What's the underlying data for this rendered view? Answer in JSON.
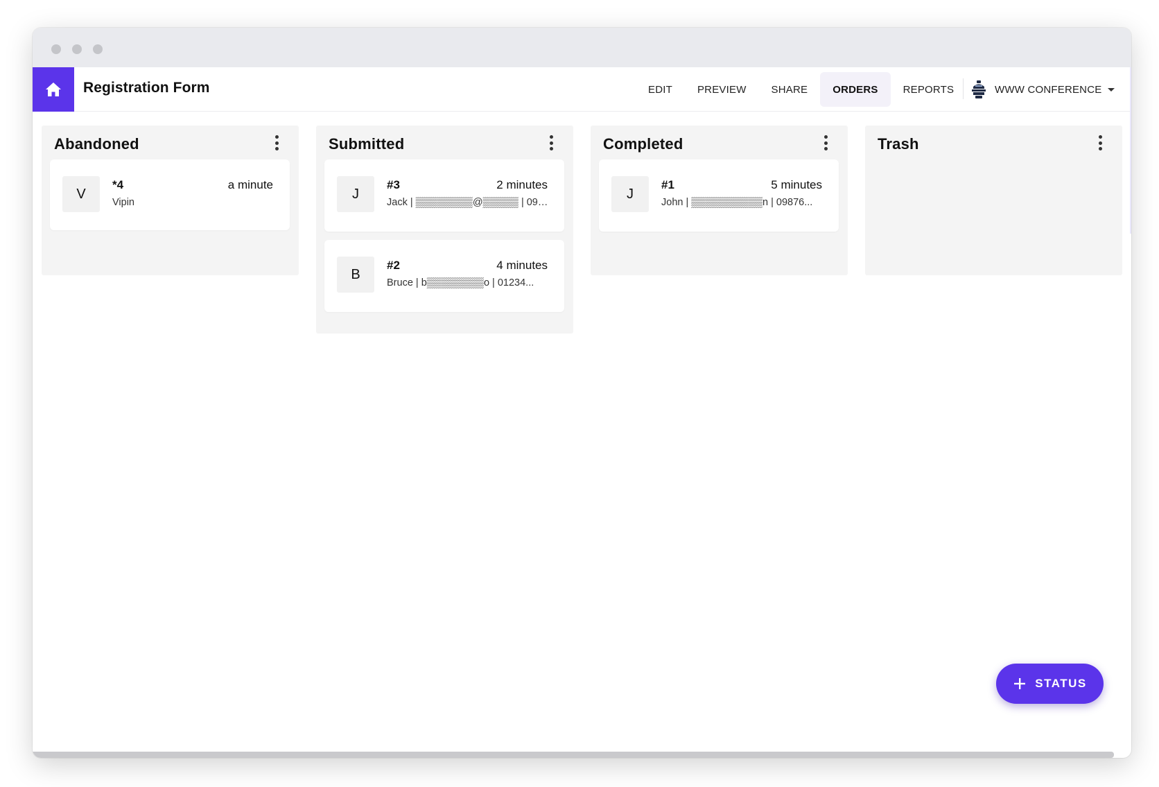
{
  "window": {
    "traffic_lights": [
      "close",
      "minimize",
      "zoom"
    ]
  },
  "appbar": {
    "home_icon": "home-icon",
    "title": "Registration Form",
    "nav": [
      {
        "label": "EDIT",
        "active": false
      },
      {
        "label": "PREVIEW",
        "active": false
      },
      {
        "label": "SHARE",
        "active": false
      },
      {
        "label": "ORDERS",
        "active": true
      },
      {
        "label": "REPORTS",
        "active": false
      }
    ],
    "org": {
      "icon": "org-logo-icon",
      "name": "WWW CONFERENCE"
    }
  },
  "columns": [
    {
      "title": "Abandoned",
      "cards": [
        {
          "avatar": "V",
          "id": "*4",
          "time": "a minute",
          "subtitle": "Vipin"
        }
      ]
    },
    {
      "title": "Submitted",
      "cards": [
        {
          "avatar": "J",
          "id": "#3",
          "time": "2 minutes",
          "subtitle": "Jack | ▒▒▒▒▒▒▒▒@▒▒▒▒▒ | 097..."
        },
        {
          "avatar": "B",
          "id": "#2",
          "time": "4 minutes",
          "subtitle": "Bruce | b▒▒▒▒▒▒▒▒o | 01234..."
        }
      ]
    },
    {
      "title": "Completed",
      "cards": [
        {
          "avatar": "J",
          "id": "#1",
          "time": "5 minutes",
          "subtitle": "John | ▒▒▒▒▒▒▒▒▒▒n | 09876..."
        }
      ]
    },
    {
      "title": "Trash",
      "cards": []
    }
  ],
  "fab": {
    "icon": "plus-icon",
    "label": "STATUS"
  },
  "colors": {
    "accent": "#5b34ea",
    "column_bg": "#f4f4f4",
    "active_tab_bg": "#f3f1f9"
  }
}
